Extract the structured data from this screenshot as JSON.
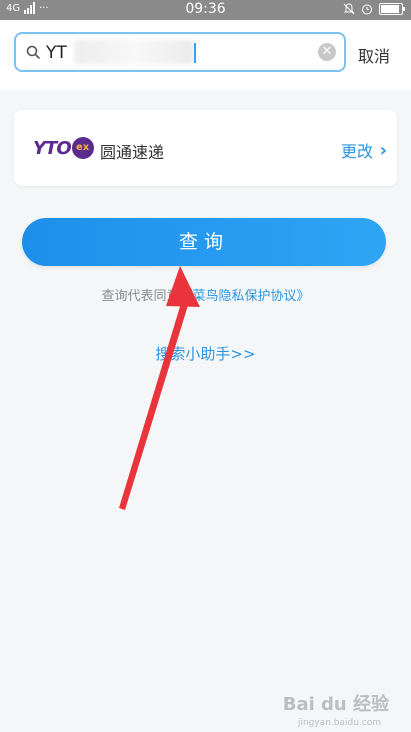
{
  "status_bar": {
    "network": "4G",
    "dots": "···",
    "time": "09:36"
  },
  "search": {
    "value": "YT"
  },
  "header": {
    "cancel_label": "取消"
  },
  "courier": {
    "logo_text": "YTO",
    "logo_mark": "ex",
    "name": "圆通速递",
    "change_label": "更改",
    "chevron": "›"
  },
  "actions": {
    "query_label": "查询"
  },
  "agreement": {
    "prefix": "查询代表同意",
    "link": "《菜鸟隐私保护协议》"
  },
  "helper": {
    "label": "搜索小助手>>"
  },
  "colors": {
    "accent": "#2a95e0",
    "button": "#1d8fea",
    "annotation_arrow": "#e8343a"
  },
  "watermark": {
    "text": "Bai du 经验",
    "sub": "jingyan.baidu.com"
  }
}
